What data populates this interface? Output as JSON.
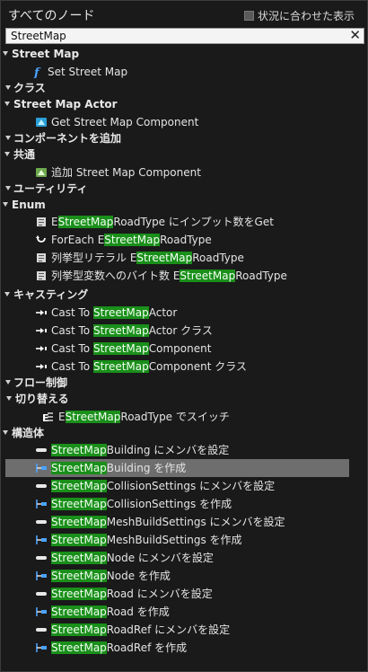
{
  "header": {
    "title": "すべてのノード",
    "context_label": "状況に合わせた表示"
  },
  "search": {
    "value": "StreetMap",
    "clear_symbol": "✕"
  },
  "rows": [
    {
      "kind": "cat",
      "parts": [
        {
          "t": "Street Map"
        }
      ]
    },
    {
      "kind": "item",
      "icon": "function-icon",
      "parts": [
        {
          "t": "Set Street Map"
        }
      ]
    },
    {
      "kind": "cat",
      "parts": [
        {
          "t": "クラス"
        }
      ]
    },
    {
      "kind": "cat",
      "parts": [
        {
          "t": "Street Map Actor"
        }
      ]
    },
    {
      "kind": "item",
      "icon": "component-icon",
      "parts": [
        {
          "t": "Get Street Map Component"
        }
      ]
    },
    {
      "kind": "cat",
      "parts": [
        {
          "t": "コンポーネントを追加"
        }
      ]
    },
    {
      "kind": "cat",
      "parts": [
        {
          "t": "共通"
        }
      ]
    },
    {
      "kind": "item",
      "icon": "add-component-icon",
      "parts": [
        {
          "t": "追加 Street Map Component"
        }
      ]
    },
    {
      "kind": "cat",
      "parts": [
        {
          "t": "ユーティリティ"
        }
      ]
    },
    {
      "kind": "cat",
      "parts": [
        {
          "t": "Enum"
        }
      ]
    },
    {
      "kind": "item",
      "icon": "enum-icon",
      "parts": [
        {
          "t": "E"
        },
        {
          "t": "StreetMap",
          "hl": true
        },
        {
          "t": "RoadType にインプット数をGet"
        }
      ]
    },
    {
      "kind": "item",
      "icon": "foreach-icon",
      "parts": [
        {
          "t": "ForEach E"
        },
        {
          "t": "StreetMap",
          "hl": true
        },
        {
          "t": "RoadType"
        }
      ]
    },
    {
      "kind": "item",
      "icon": "enum-icon",
      "parts": [
        {
          "t": "列挙型リテラル E"
        },
        {
          "t": "StreetMap",
          "hl": true
        },
        {
          "t": "RoadType"
        }
      ]
    },
    {
      "kind": "item",
      "icon": "enum-icon",
      "parts": [
        {
          "t": "列挙型変数へのバイト数 E"
        },
        {
          "t": "StreetMap",
          "hl": true
        },
        {
          "t": "RoadType"
        }
      ]
    },
    {
      "kind": "cat",
      "parts": [
        {
          "t": "キャスティング"
        }
      ]
    },
    {
      "kind": "item",
      "icon": "cast-icon",
      "parts": [
        {
          "t": "Cast To "
        },
        {
          "t": "StreetMap",
          "hl": true
        },
        {
          "t": "Actor"
        }
      ]
    },
    {
      "kind": "item",
      "icon": "cast-icon",
      "parts": [
        {
          "t": "Cast To "
        },
        {
          "t": "StreetMap",
          "hl": true
        },
        {
          "t": "Actor クラス"
        }
      ]
    },
    {
      "kind": "item",
      "icon": "cast-icon",
      "parts": [
        {
          "t": "Cast To "
        },
        {
          "t": "StreetMap",
          "hl": true
        },
        {
          "t": "Component"
        }
      ]
    },
    {
      "kind": "item",
      "icon": "cast-icon",
      "parts": [
        {
          "t": "Cast To "
        },
        {
          "t": "StreetMap",
          "hl": true
        },
        {
          "t": "Component クラス"
        }
      ]
    },
    {
      "kind": "cat",
      "parts": [
        {
          "t": "フロー制御"
        }
      ]
    },
    {
      "kind": "cat",
      "parts": [
        {
          "t": "切り替える"
        }
      ]
    },
    {
      "kind": "item",
      "icon": "switch-icon",
      "parts": [
        {
          "t": "E"
        },
        {
          "t": "StreetMap",
          "hl": true
        },
        {
          "t": "RoadType でスイッチ"
        }
      ]
    },
    {
      "kind": "cat",
      "parts": [
        {
          "t": "構造体"
        }
      ]
    },
    {
      "kind": "item",
      "icon": "set-members-icon",
      "parts": [
        {
          "t": "StreetMap",
          "hl": true
        },
        {
          "t": "Building にメンバを設定"
        }
      ]
    },
    {
      "kind": "item",
      "icon": "make-struct-icon",
      "selected": true,
      "parts": [
        {
          "t": "StreetMap",
          "hl": true
        },
        {
          "t": "Building を作成"
        }
      ]
    },
    {
      "kind": "item",
      "icon": "set-members-icon",
      "parts": [
        {
          "t": "StreetMap",
          "hl": true
        },
        {
          "t": "CollisionSettings にメンバを設定"
        }
      ]
    },
    {
      "kind": "item",
      "icon": "make-struct-icon",
      "parts": [
        {
          "t": "StreetMap",
          "hl": true
        },
        {
          "t": "CollisionSettings を作成"
        }
      ]
    },
    {
      "kind": "item",
      "icon": "set-members-icon",
      "parts": [
        {
          "t": "StreetMap",
          "hl": true
        },
        {
          "t": "MeshBuildSettings にメンバを設定"
        }
      ]
    },
    {
      "kind": "item",
      "icon": "make-struct-icon",
      "parts": [
        {
          "t": "StreetMap",
          "hl": true
        },
        {
          "t": "MeshBuildSettings を作成"
        }
      ]
    },
    {
      "kind": "item",
      "icon": "set-members-icon",
      "parts": [
        {
          "t": "StreetMap",
          "hl": true
        },
        {
          "t": "Node にメンバを設定"
        }
      ]
    },
    {
      "kind": "item",
      "icon": "make-struct-icon",
      "parts": [
        {
          "t": "StreetMap",
          "hl": true
        },
        {
          "t": "Node を作成"
        }
      ]
    },
    {
      "kind": "item",
      "icon": "set-members-icon",
      "parts": [
        {
          "t": "StreetMap",
          "hl": true
        },
        {
          "t": "Road にメンバを設定"
        }
      ]
    },
    {
      "kind": "item",
      "icon": "make-struct-icon",
      "parts": [
        {
          "t": "StreetMap",
          "hl": true
        },
        {
          "t": "Road を作成"
        }
      ]
    },
    {
      "kind": "item",
      "icon": "set-members-icon",
      "parts": [
        {
          "t": "StreetMap",
          "hl": true
        },
        {
          "t": "RoadRef にメンバを設定"
        }
      ]
    },
    {
      "kind": "item",
      "icon": "make-struct-icon",
      "parts": [
        {
          "t": "StreetMap",
          "hl": true
        },
        {
          "t": "RoadRef を作成"
        }
      ]
    }
  ]
}
